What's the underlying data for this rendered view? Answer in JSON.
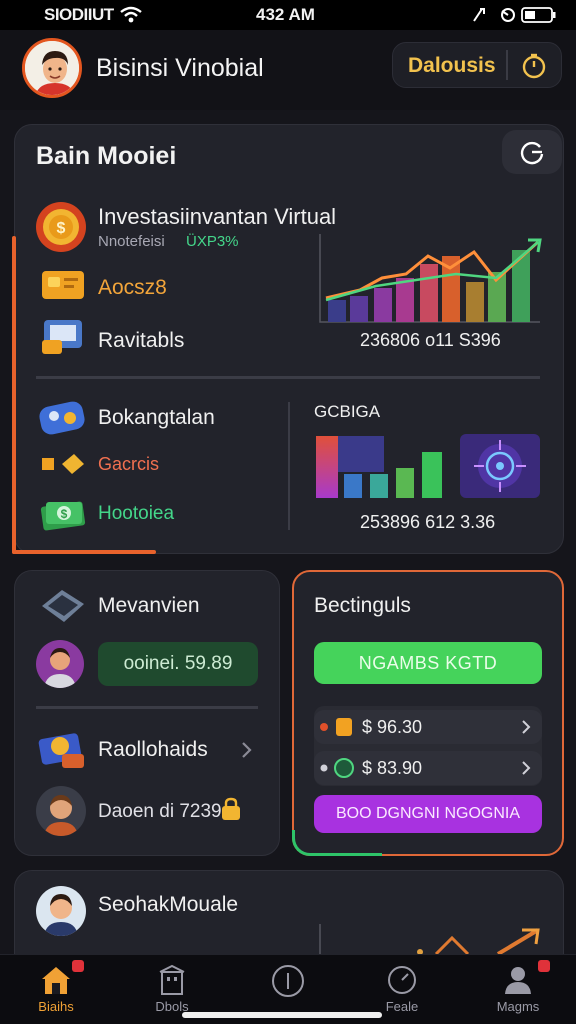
{
  "status_bar": {
    "carrier": "SIODIIUT",
    "time": "432 AM"
  },
  "header": {
    "app_title": "Bisinsi Vinobial",
    "dash_label": "Dalousis"
  },
  "main_card": {
    "title": "Bain Mooiei",
    "investment": {
      "title": "Investasiinvantan Virtual",
      "subtitle": "Nnotefeisi ",
      "subtitle_accent": "ÜXP3%"
    },
    "items": [
      {
        "label": "Aocsz8",
        "icon": "gold-card-icon"
      },
      {
        "label": "Ravitabls",
        "icon": "wallet-icon"
      }
    ],
    "chart1_value": "236806 o11 S396",
    "section2_title": "Bokangtalan",
    "section2_items": [
      {
        "label": "Gacrcis",
        "icon": "gold-coins-icon"
      },
      {
        "label": "Hootoiea",
        "icon": "cash-icon"
      }
    ],
    "chart2_label": "GCBIGA",
    "chart2_value": "253896 612 3.36"
  },
  "left_card": {
    "title": "Mevanvien",
    "balance": "ooinei. 59.89",
    "item_label": "Raollohaids",
    "footer": "Daoen di 7239"
  },
  "right_card": {
    "title": "Bectinguls",
    "green_button": "NGAMBS KGTD",
    "price1": "$ 96.30",
    "price2": "$ 83.90",
    "purple_button": "BOO DGNGNI NGOGNIA"
  },
  "third_card": {
    "title": "SeohakMouale"
  },
  "tabs": [
    {
      "label": "Biaihs",
      "icon": "home-icon",
      "active": true
    },
    {
      "label": "Dbols",
      "icon": "building-icon",
      "active": false
    },
    {
      "label": "",
      "icon": "plus-icon",
      "active": false
    },
    {
      "label": "Feale",
      "icon": "timer-icon",
      "active": false
    },
    {
      "label": "Magms",
      "icon": "person-icon",
      "active": false
    }
  ],
  "colors": {
    "accent_orange": "#e8622c",
    "gold": "#f2c24e",
    "green": "#45d35b",
    "purple": "#a832e0",
    "card_bg": "#22232b"
  }
}
